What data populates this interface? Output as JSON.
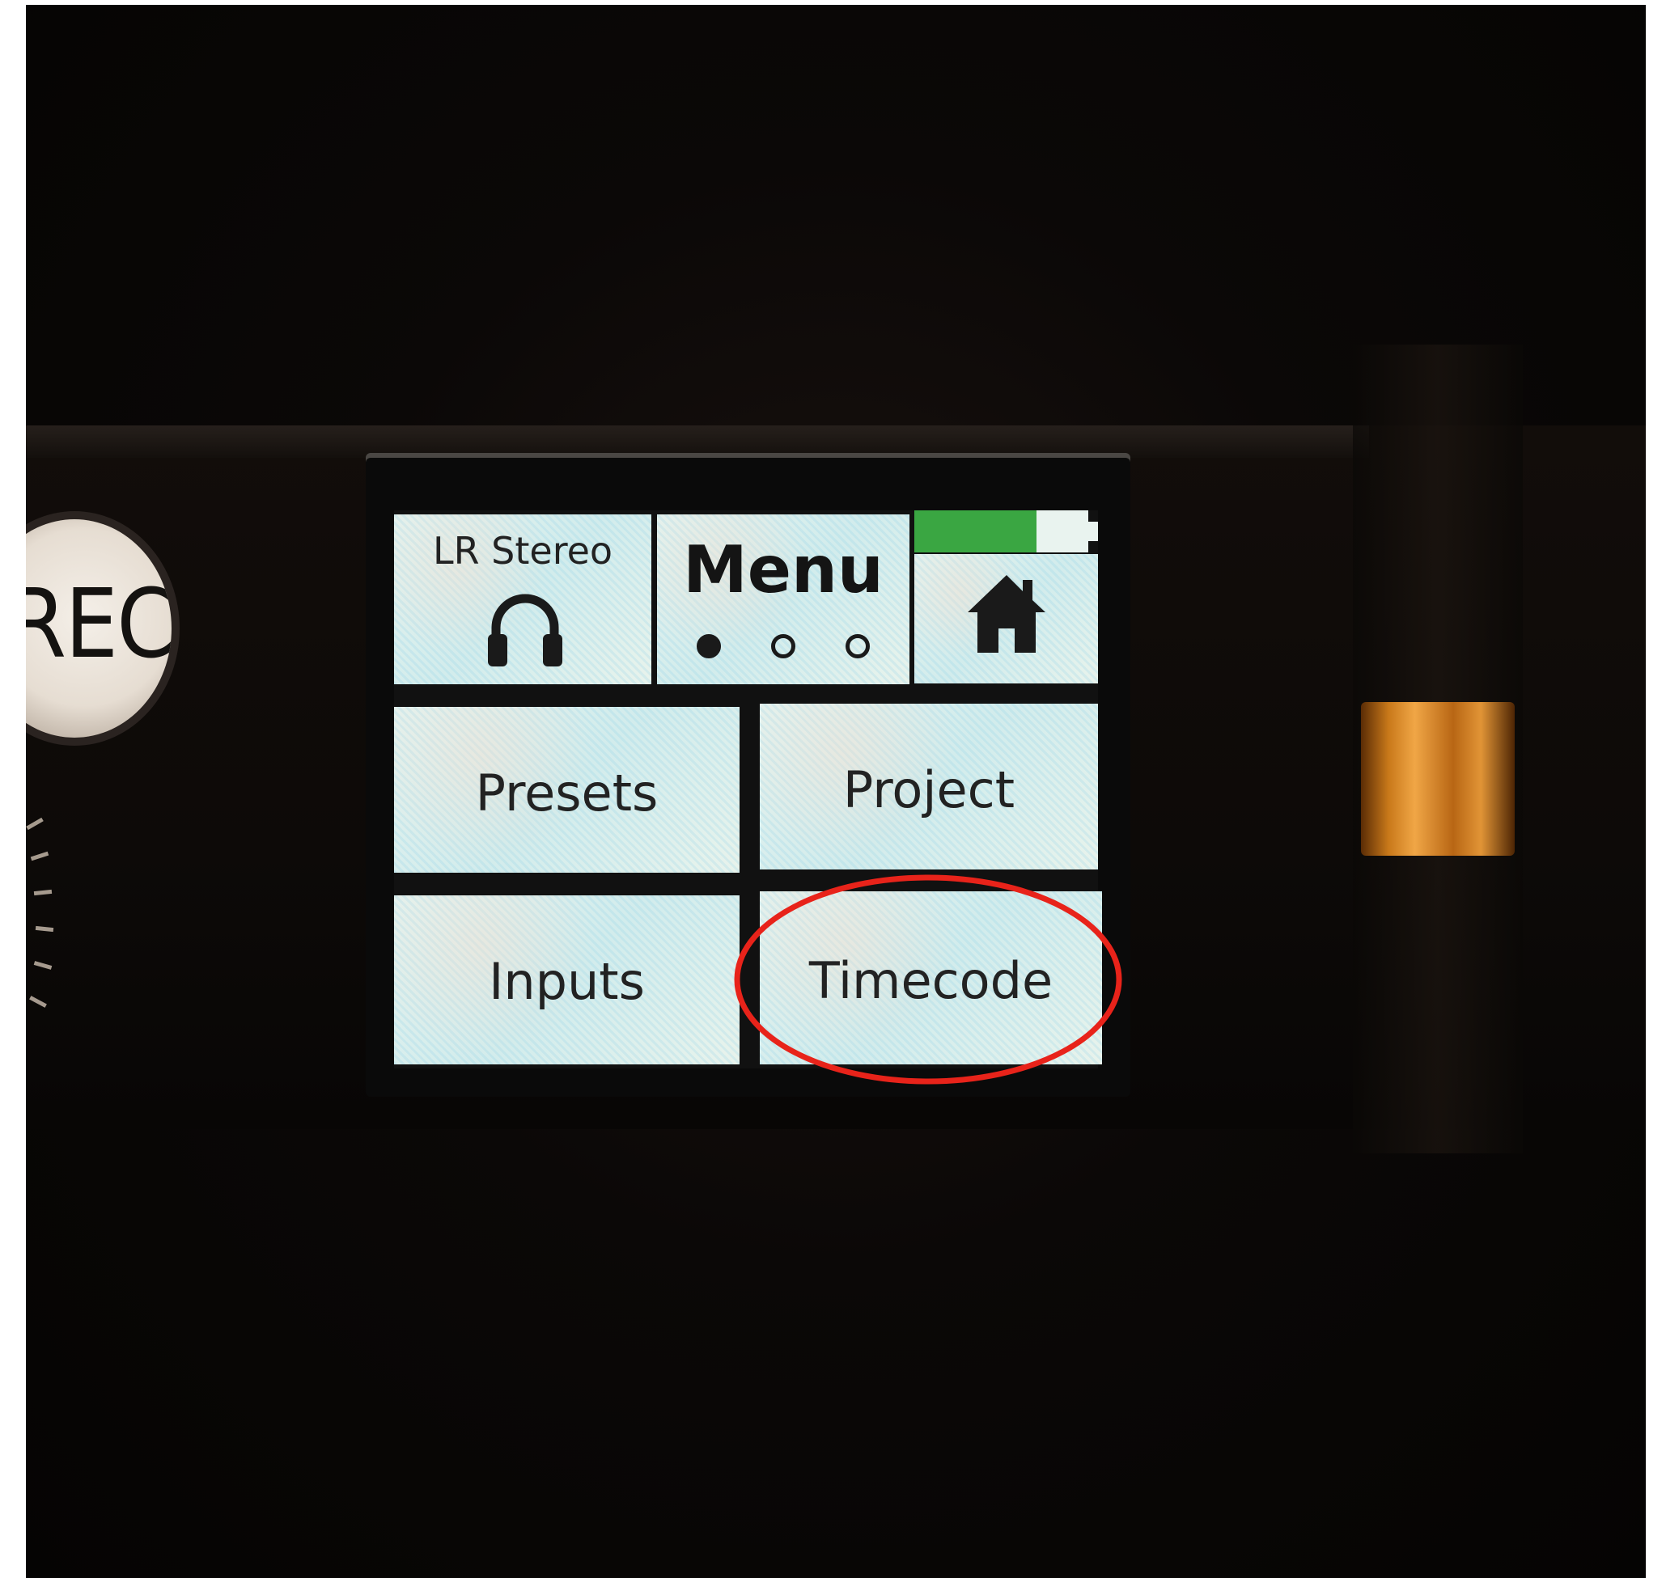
{
  "rec_button": {
    "label": "REC"
  },
  "screen": {
    "output_tile": {
      "label": "LR Stereo",
      "icon": "headphones-icon"
    },
    "menu_tile": {
      "title": "Menu",
      "page_count": 3,
      "current_page": 1
    },
    "home_tile": {
      "icon": "home-icon"
    },
    "battery": {
      "level": 0.7,
      "color": "#3aa642"
    },
    "tiles": {
      "presets": "Presets",
      "project": "Project",
      "inputs": "Inputs",
      "timecode": "Timecode"
    }
  },
  "annotation": {
    "highlighted": "Timecode",
    "color": "#e8231a"
  },
  "orange_knob": {
    "color": "#e19436"
  }
}
